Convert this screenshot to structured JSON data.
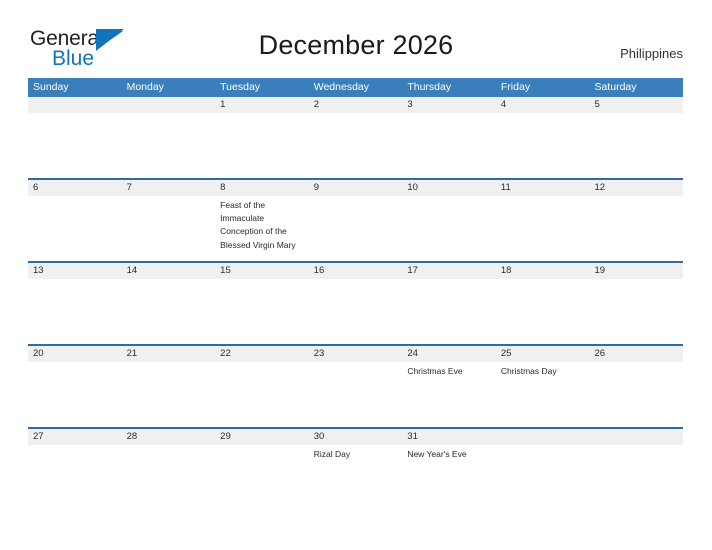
{
  "brand": {
    "name_part1": "General",
    "name_part2": "Blue",
    "flag_icon": "blue-flag-triangle",
    "accent_color": "#1274bc"
  },
  "header": {
    "title": "December 2026",
    "region": "Philippines"
  },
  "colors": {
    "header_blue": "#3b7ebc",
    "row_divider_blue": "#2e6da4",
    "date_band_gray": "#f0f0f0",
    "text": "#2a2a2a"
  },
  "calendar": {
    "month": "December",
    "year": "2026",
    "weekday_headers": [
      "Sunday",
      "Monday",
      "Tuesday",
      "Wednesday",
      "Thursday",
      "Friday",
      "Saturday"
    ],
    "weeks": [
      {
        "days": [
          {
            "date": "",
            "event": ""
          },
          {
            "date": "",
            "event": ""
          },
          {
            "date": "1",
            "event": ""
          },
          {
            "date": "2",
            "event": ""
          },
          {
            "date": "3",
            "event": ""
          },
          {
            "date": "4",
            "event": ""
          },
          {
            "date": "5",
            "event": ""
          }
        ]
      },
      {
        "days": [
          {
            "date": "6",
            "event": ""
          },
          {
            "date": "7",
            "event": ""
          },
          {
            "date": "8",
            "event": "Feast of the Immaculate Conception of the Blessed Virgin Mary"
          },
          {
            "date": "9",
            "event": ""
          },
          {
            "date": "10",
            "event": ""
          },
          {
            "date": "11",
            "event": ""
          },
          {
            "date": "12",
            "event": ""
          }
        ]
      },
      {
        "days": [
          {
            "date": "13",
            "event": ""
          },
          {
            "date": "14",
            "event": ""
          },
          {
            "date": "15",
            "event": ""
          },
          {
            "date": "16",
            "event": ""
          },
          {
            "date": "17",
            "event": ""
          },
          {
            "date": "18",
            "event": ""
          },
          {
            "date": "19",
            "event": ""
          }
        ]
      },
      {
        "days": [
          {
            "date": "20",
            "event": ""
          },
          {
            "date": "21",
            "event": ""
          },
          {
            "date": "22",
            "event": ""
          },
          {
            "date": "23",
            "event": ""
          },
          {
            "date": "24",
            "event": "Christmas Eve"
          },
          {
            "date": "25",
            "event": "Christmas Day"
          },
          {
            "date": "26",
            "event": ""
          }
        ]
      },
      {
        "days": [
          {
            "date": "27",
            "event": ""
          },
          {
            "date": "28",
            "event": ""
          },
          {
            "date": "29",
            "event": ""
          },
          {
            "date": "30",
            "event": "Rizal Day"
          },
          {
            "date": "31",
            "event": "New Year's Eve"
          },
          {
            "date": "",
            "event": ""
          },
          {
            "date": "",
            "event": ""
          }
        ]
      }
    ]
  }
}
